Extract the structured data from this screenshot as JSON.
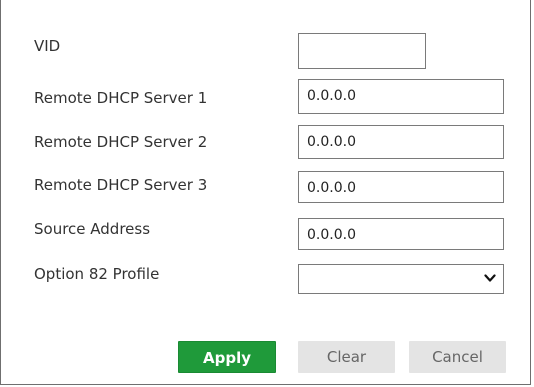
{
  "form": {
    "vid": {
      "label": "VID",
      "value": ""
    },
    "remote_dhcp_server_1": {
      "label": "Remote DHCP Server 1",
      "value": "0.0.0.0"
    },
    "remote_dhcp_server_2": {
      "label": "Remote DHCP Server 2",
      "value": "0.0.0.0"
    },
    "remote_dhcp_server_3": {
      "label": "Remote DHCP Server 3",
      "value": "0.0.0.0"
    },
    "source_address": {
      "label": "Source Address",
      "value": "0.0.0.0"
    },
    "option82_profile": {
      "label": "Option 82 Profile",
      "selected": "",
      "icon": "chevron-down-icon"
    }
  },
  "buttons": {
    "apply": "Apply",
    "clear": "Clear",
    "cancel": "Cancel"
  },
  "colors": {
    "apply_bg": "#1f9a3a",
    "secondary_bg": "#e4e4e4",
    "border": "#7a7a7a"
  }
}
